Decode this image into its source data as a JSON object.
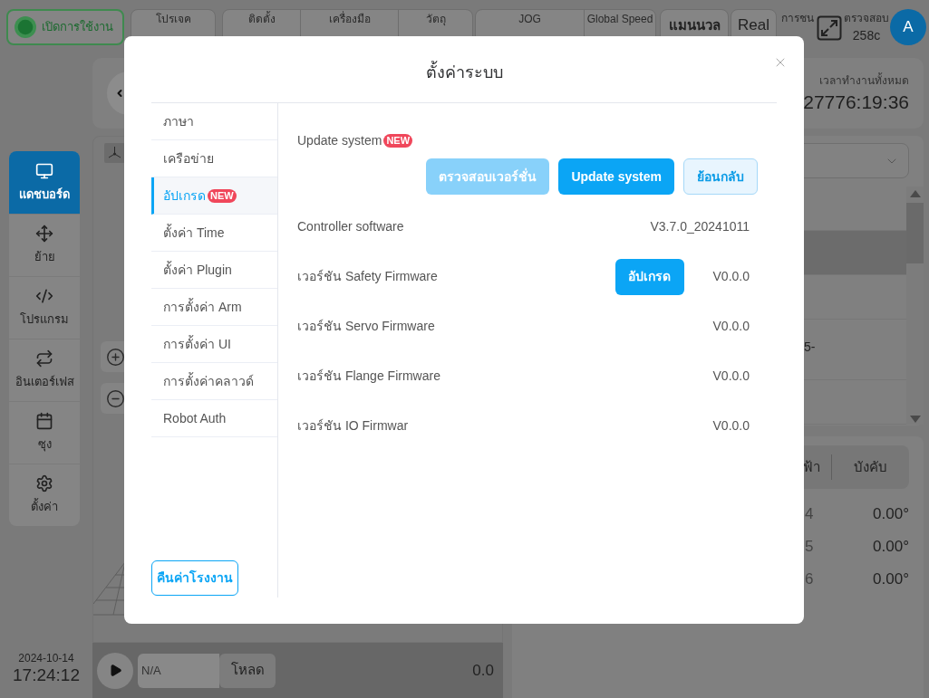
{
  "top_bar": {
    "enable_button": {
      "label": "เปิดการใช้งาน",
      "on": true
    },
    "project": {
      "label": "โปรเจค"
    },
    "setup": [
      {
        "label": "ติดตั้ง"
      },
      {
        "label": "เครื่องมือ"
      },
      {
        "label": "วัตถุ"
      }
    ],
    "speed": [
      {
        "label": "JOG"
      },
      {
        "label": "Global Speed"
      }
    ],
    "mode_button": "แมนนวล",
    "real_button": "Real",
    "collision": {
      "label": "การชน"
    },
    "inspection": {
      "label": "ตรวจสอบ",
      "value": "258c"
    },
    "avatar": "A"
  },
  "sidebar": {
    "items": [
      {
        "label": "แดชบอร์ด",
        "selected": true
      },
      {
        "label": "ย้าย",
        "selected": false
      },
      {
        "label": "โปรแกรม",
        "selected": false
      },
      {
        "label": "อินเตอร์เฟส",
        "selected": false
      },
      {
        "label": "ซุง",
        "selected": false
      },
      {
        "label": "ตั้งค่า",
        "selected": false
      }
    ]
  },
  "clock": {
    "date": "2024-10-14",
    "time": "17:24:12"
  },
  "run_time": {
    "label": "เวลาทำงานทั้งหมด",
    "value": "27776:19:36"
  },
  "program_list": {
    "rows": [
      {
        "selected": false
      },
      {
        "selected": true
      },
      {
        "selected": false
      },
      {
        "text": "5-",
        "selected": false
      },
      {
        "selected": false
      }
    ]
  },
  "joint_panel": {
    "tabs": [
      {
        "label": "ฟ้า",
        "selected": false
      },
      {
        "label": "บังคับ",
        "selected": false
      }
    ],
    "joints": [
      {
        "label": "4",
        "value": "0.00°"
      },
      {
        "label": "5",
        "value": "0.00°"
      },
      {
        "label": "6",
        "value": "0.00°"
      }
    ]
  },
  "run_bar": {
    "program": "N/A",
    "load_button": "โหลด",
    "speed": "0.0"
  },
  "dialog": {
    "title": "ตั้งค่าระบบ",
    "menu": [
      {
        "label": "ภาษา",
        "selected": false
      },
      {
        "label": "เครือข่าย",
        "selected": false
      },
      {
        "label": "อัปเกรด",
        "badge": "NEW",
        "selected": true
      },
      {
        "label": "ตั้งค่า Time",
        "selected": false
      },
      {
        "label": "ตั้งค่า Plugin",
        "selected": false
      },
      {
        "label": "การตั้งค่า Arm",
        "selected": false
      },
      {
        "label": "การตั้งค่า UI",
        "selected": false
      },
      {
        "label": "การตั้งค่าคลาวด์",
        "selected": false
      },
      {
        "label": "Robot Auth",
        "selected": false
      }
    ],
    "factory_reset_button": "คืนค่าโรงงาน",
    "update": {
      "label": "Update system",
      "badge": "NEW"
    },
    "actions": [
      {
        "label": "ตรวจสอบเวอร์ชั่น",
        "kind": "primary",
        "disabled": true
      },
      {
        "label": "Update system",
        "kind": "primary",
        "disabled": false
      },
      {
        "label": "ย้อนกลับ",
        "kind": "secondary",
        "disabled": false
      }
    ],
    "versions": [
      {
        "label": "Controller software",
        "value": "V3.7.0_20241011"
      },
      {
        "label": "เวอร์ชัน Safety Firmware",
        "button": "อัปเกรด",
        "value": "V0.0.0"
      },
      {
        "label": "เวอร์ชัน Servo Firmware",
        "value": "V0.0.0"
      },
      {
        "label": "เวอร์ชัน Flange Firmware",
        "value": "V0.0.0"
      },
      {
        "label": "เวอร์ชัน IO Firmwar",
        "value": "V0.0.0"
      }
    ]
  }
}
